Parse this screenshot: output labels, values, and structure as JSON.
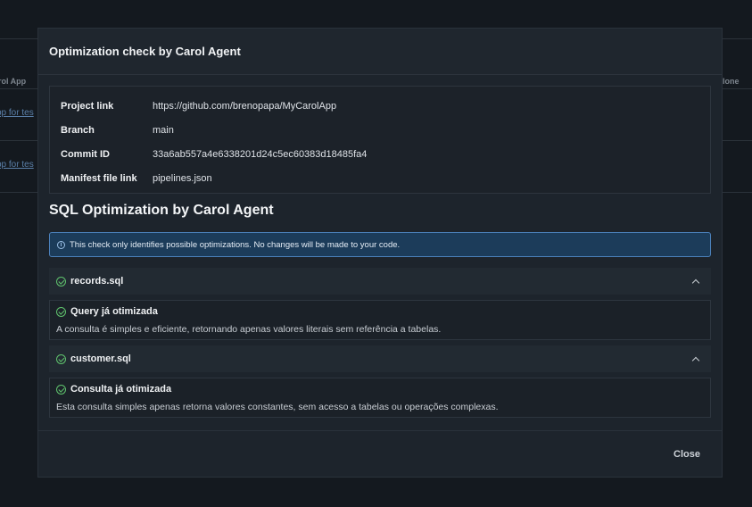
{
  "background": {
    "col_left": "rol App",
    "col_right": "lone",
    "rows": [
      {
        "link": "pp for tes"
      },
      {
        "link": "pp for tes"
      }
    ]
  },
  "modal": {
    "title": "Optimization check by Carol Agent",
    "info": [
      {
        "key": "Project link",
        "value": "https://github.com/brenopapa/MyCarolApp"
      },
      {
        "key": "Branch",
        "value": "main"
      },
      {
        "key": "Commit ID",
        "value": "33a6ab557a4e6338201d24c5ec60383d18485fa4"
      },
      {
        "key": "Manifest file link",
        "value": "pipelines.json"
      }
    ],
    "section_title": "SQL Optimization by Carol Agent",
    "notice": "This check only identifies possible optimizations. No changes will be made to your code.",
    "files": [
      {
        "name": "records.sql",
        "result_title": "Query já otimizada",
        "result_desc": "A consulta é simples e eficiente, retornando apenas valores literais sem referência a tabelas."
      },
      {
        "name": "customer.sql",
        "result_title": "Consulta já otimizada",
        "result_desc": "Esta consulta simples apenas retorna valores constantes, sem acesso a tabelas ou operações complexas."
      }
    ],
    "close_label": "Close"
  },
  "colors": {
    "overlay_bg": "#14191f",
    "modal_bg": "#1d242c",
    "notice_bg": "#1c3c5a",
    "notice_border": "#4b80ba",
    "success": "#5fc26d"
  }
}
